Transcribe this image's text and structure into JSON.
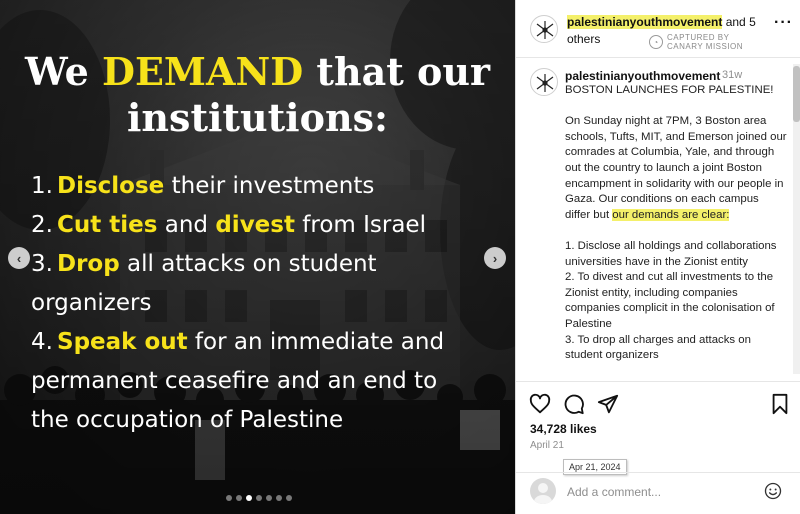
{
  "slide": {
    "headline_part1": "We ",
    "headline_highlight": "DEMAND",
    "headline_part2": " that our",
    "headline_line2": "institutions:",
    "demands": [
      {
        "num": "1.",
        "highlight": "Disclose",
        "rest": " their investments"
      },
      {
        "num": "2.",
        "highlight": "Cut ties",
        "mid": " and ",
        "highlight2": "divest",
        "rest": " from Israel"
      },
      {
        "num": "3.",
        "highlight": "Drop",
        "rest": " all attacks on student",
        "cont": "organizers"
      },
      {
        "num": "4.",
        "highlight": "Speak out",
        "rest": " for an immediate and",
        "cont": "permanent ceasefire and an end to",
        "cont2": "the occupation of Palestine"
      }
    ],
    "prev_arrow": "‹",
    "next_arrow": "›",
    "dot_count": 7,
    "active_dot": 2
  },
  "post_header": {
    "username": "palestinianyouthmovement",
    "coauthors": " and 5",
    "coauthors_line2": "others",
    "more_label": "···"
  },
  "watermark": {
    "icon": "canary-mission-icon",
    "line1": "CAPTURED BY",
    "line2": "CANARY MISSION"
  },
  "caption": {
    "username": "palestinianyouthmovement",
    "time": "31w",
    "title": "BOSTON LAUNCHES FOR PALESTINE!",
    "para1": "On Sunday night at 7PM, 3 Boston area schools, Tufts, MIT, and Emerson joined our comrades at Columbia, Yale, and through out the country to launch a joint Boston encampment in solidarity with our people in Gaza. Our conditions on each campus differ but ",
    "para1_highlight": "our demands are clear:",
    "items": "1. Disclose all holdings and collaborations universities have in the Zionist entity\n2. To divest and cut all investments to the Zionist entity, including companies companies complicit in the colonisation of Palestine\n3. To drop all charges and attacks on student organizers"
  },
  "actions": {
    "like_icon": "heart-icon",
    "comment_icon": "comment-icon",
    "share_icon": "share-icon",
    "save_icon": "bookmark-icon"
  },
  "stats": {
    "likes": "34,728 likes",
    "date": "April 21",
    "tooltip": "Apr 21, 2024"
  },
  "comment": {
    "placeholder": "Add a comment...",
    "emoji_icon": "emoji-icon"
  },
  "colors": {
    "accent_yellow": "#f7e21a",
    "highlight_yellow": "#f4f06a",
    "panel_text": "#222222",
    "muted": "#8e8e8e"
  }
}
